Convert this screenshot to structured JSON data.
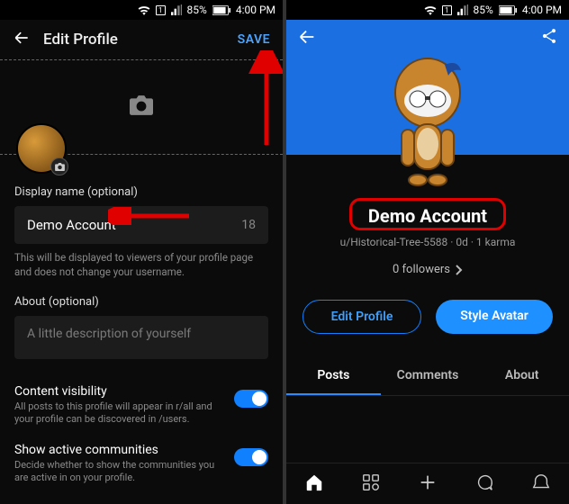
{
  "status": {
    "battery_pct": "85%",
    "time": "4:00 PM",
    "sim": "1"
  },
  "left": {
    "title": "Edit Profile",
    "save": "SAVE",
    "display_name_label": "Display name (optional)",
    "display_name_value": "Demo Account",
    "display_name_counter": "18",
    "display_name_hint": "This will be displayed to viewers of your profile page and does not change your username.",
    "about_label": "About (optional)",
    "about_placeholder": "A little description of yourself",
    "content_vis_title": "Content visibility",
    "content_vis_sub": "All posts to this profile will appear in r/all and your profile can be discovered in /users.",
    "show_comm_title": "Show active communities",
    "show_comm_sub": "Decide whether to show the communities you are active in on your profile."
  },
  "right": {
    "display_name": "Demo Account",
    "userline": "u/Historical-Tree-5588 · 0d · 1 karma",
    "followers": "0 followers",
    "edit_profile": "Edit Profile",
    "style_avatar": "Style Avatar",
    "tabs": {
      "posts": "Posts",
      "comments": "Comments",
      "about": "About"
    }
  }
}
